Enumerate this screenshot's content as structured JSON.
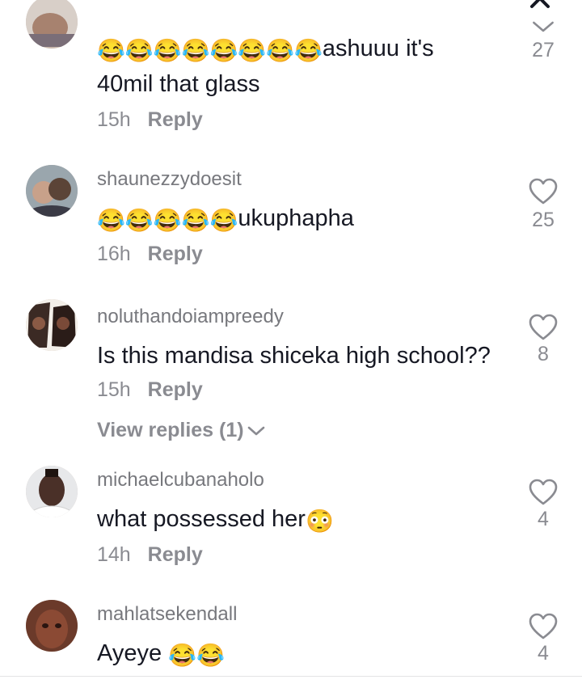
{
  "icons": {
    "close": "close-icon",
    "heart": "heart-outline-icon",
    "chevron": "chevron-down-icon",
    "laugh_emoji": "😂",
    "flushed_emoji": "😳"
  },
  "colors": {
    "text": "#161823",
    "muted": "#8a8b91",
    "username": "#77787d"
  },
  "comments": [
    {
      "username": "",
      "text_line1_emoji": "😂😂😂😂😂😂😂😂",
      "text_line1_text": "ashuuu it's",
      "text_line2": "40mil that glass",
      "time": "15h",
      "reply": "Reply",
      "likes": "27"
    },
    {
      "username": "shaunezzydoesit",
      "text_emoji": "😂😂😂😂😂",
      "text": "ukuphapha",
      "time": "16h",
      "reply": "Reply",
      "likes": "25"
    },
    {
      "username": "noluthandoiampreedy",
      "text": "Is this mandisa shiceka high school??",
      "time": "15h",
      "reply": "Reply",
      "likes": "8",
      "view_replies": "View replies (1)"
    },
    {
      "username": "michaelcubanaholo",
      "text": "what possessed her",
      "text_emoji": "😳",
      "time": "14h",
      "reply": "Reply",
      "likes": "4"
    },
    {
      "username": "mahlatsekendall",
      "text": "Ayeye ",
      "text_emoji": "😂😂",
      "likes": "4"
    }
  ]
}
